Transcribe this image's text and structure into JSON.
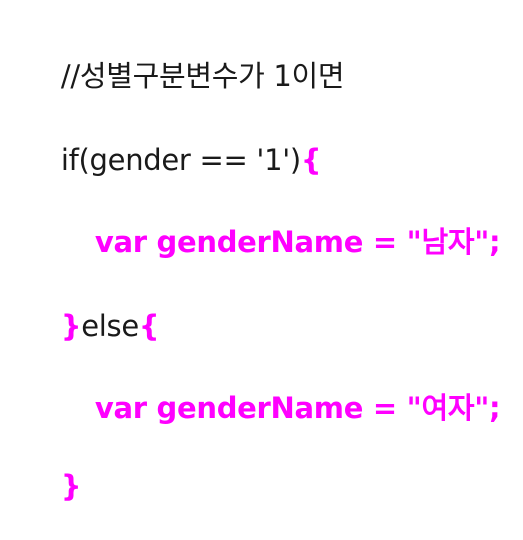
{
  "code": {
    "comment": "//성별구분변수가 1이면",
    "if_prefix": "if(gender == '1')",
    "open_brace": "{",
    "assign_male": "var genderName = \"남자\";",
    "close_brace": "}",
    "else_keyword": "else",
    "else_open_brace": "{",
    "assign_female": "var genderName = \"여자\";",
    "final_close_brace": "}"
  },
  "colors": {
    "highlight": "#ff00ff",
    "text": "#1a1a1a",
    "background": "#ffffff"
  }
}
